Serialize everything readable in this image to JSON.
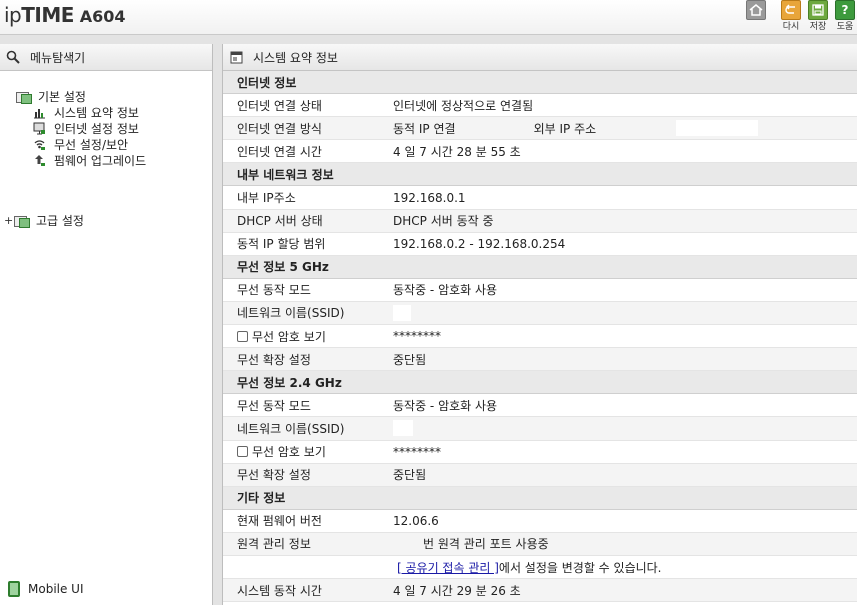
{
  "header": {
    "logo_ip": "ip",
    "logo_time": "TIME",
    "model": "A604",
    "buttons": [
      {
        "label": "",
        "icon": "home-icon"
      },
      {
        "label": "다시",
        "icon": "redo-icon"
      },
      {
        "label": "저장",
        "icon": "save-icon"
      },
      {
        "label": "도움",
        "icon": "help-icon"
      }
    ]
  },
  "left_panel": {
    "title": "메뉴탐색기",
    "tree": {
      "basic": "기본 설정",
      "items": [
        "시스템 요약 정보",
        "인터넷 설정 정보",
        "무선 설정/보안",
        "펌웨어 업그레이드"
      ],
      "advanced": "고급 설정"
    },
    "mobile_ui": "Mobile UI"
  },
  "right_panel": {
    "title": "시스템 요약 정보",
    "internet": {
      "title": "인터넷 정보",
      "status_label": "인터넷 연결 상태",
      "status_value": "인터넷에 정상적으로 연결됨",
      "method_label": "인터넷 연결 방식",
      "method_value": "동적 IP 연결",
      "external_ip_label": "외부 IP 주소",
      "time_label": "인터넷 연결 시간",
      "time_value": "4 일 7 시간 28 분 55 초"
    },
    "lan": {
      "title": "내부 네트워크 정보",
      "ip_label": "내부 IP주소",
      "ip_value": "192.168.0.1",
      "dhcp_label": "DHCP 서버 상태",
      "dhcp_value": "DHCP 서버 동작 중",
      "range_label": "동적 IP 할당 범위",
      "range_value": "192.168.0.2 -  192.168.0.254"
    },
    "wifi5": {
      "title": "무선 정보 5 GHz",
      "mode_label": "무선 동작 모드",
      "mode_value": "동작중 - 암호화 사용",
      "ssid_label": "네트워크 이름(SSID)",
      "pw_label": "무선 암호 보기",
      "pw_value": "********",
      "ext_label": "무선 확장 설정",
      "ext_value": "중단됨"
    },
    "wifi24": {
      "title": "무선 정보 2.4 GHz",
      "mode_label": "무선 동작 모드",
      "mode_value": "동작중 - 암호화 사용",
      "ssid_label": "네트워크 이름(SSID)",
      "pw_label": "무선 암호 보기",
      "pw_value": "********",
      "ext_label": "무선 확장 설정",
      "ext_value": "중단됨"
    },
    "etc": {
      "title": "기타 정보",
      "fw_label": "현재 펌웨어 버전",
      "fw_value": "12.06.6",
      "remote_label": "원격 관리 정보",
      "remote_value": "번 원격 관리 포트 사용중",
      "remote_link": "[ 공유기 접속 관리 ]",
      "remote_note": " 에서 설정을 변경할 수 있습니다.",
      "uptime_label": "시스템 동작 시간",
      "uptime_value": "4 일 7 시간 29 분 26 초"
    }
  }
}
